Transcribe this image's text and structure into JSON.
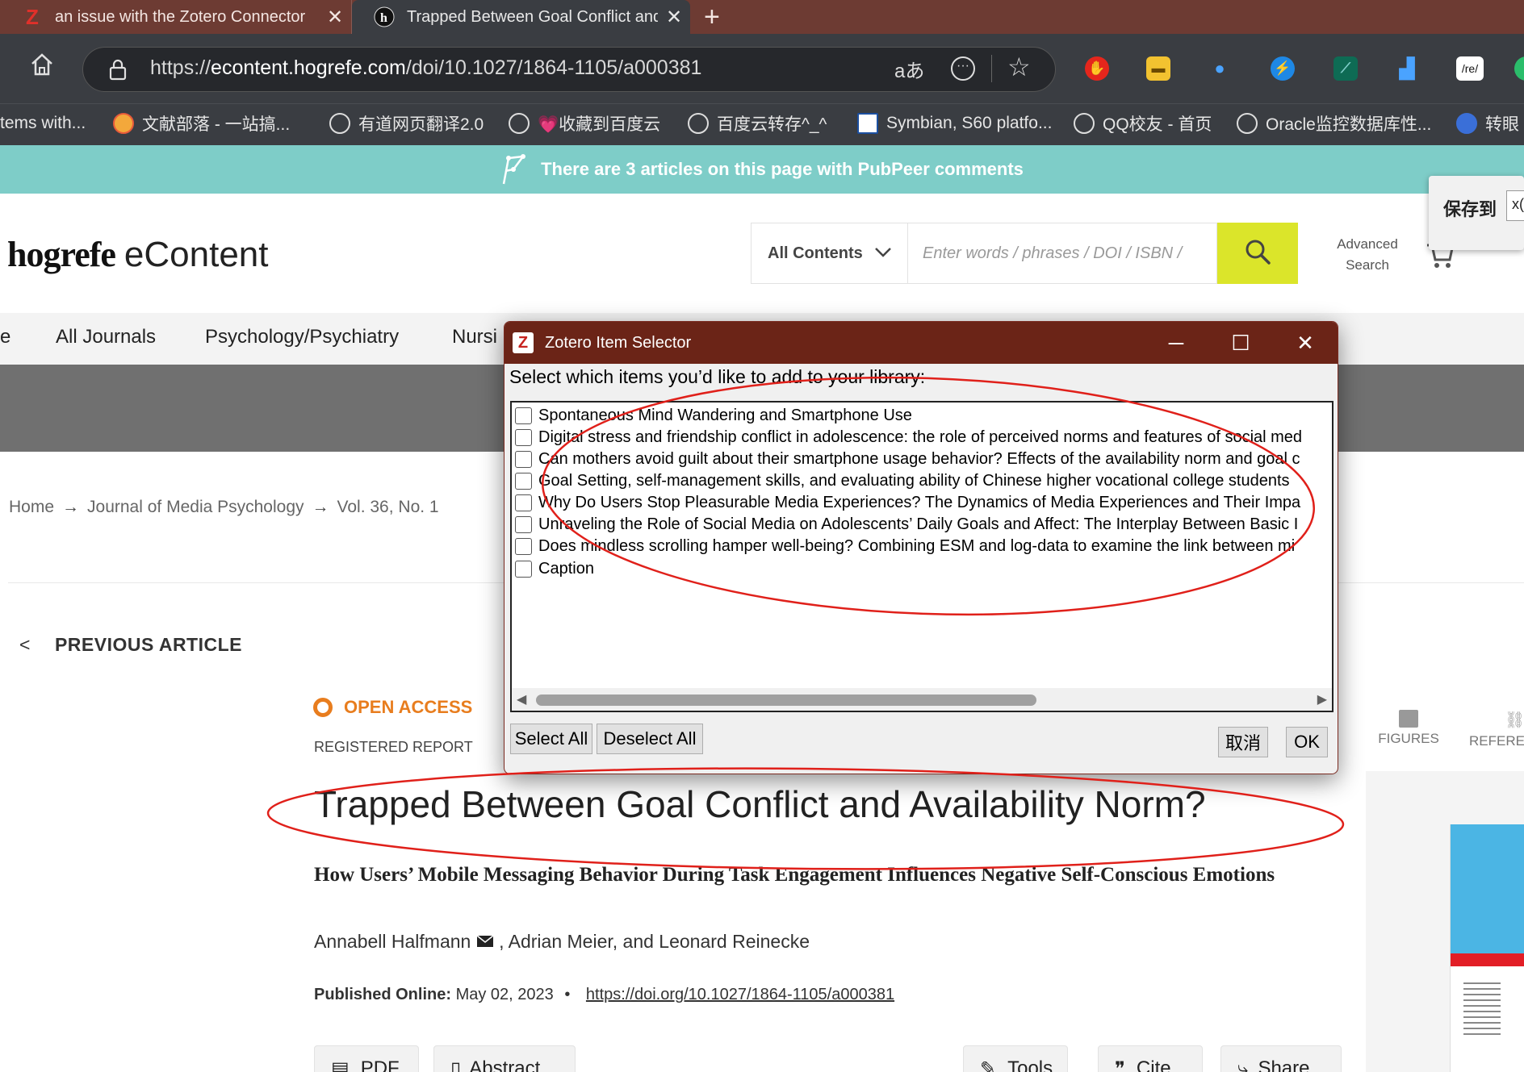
{
  "browser": {
    "tabs": [
      {
        "title": "an issue with the Zotero Connector",
        "active": false
      },
      {
        "title": "Trapped Between Goal Conflict and Availability Norm?",
        "active": true
      }
    ],
    "url_scheme": "https://",
    "url_domain": "econtent.hogrefe.com",
    "url_path": "/doi/10.1027/1864-1105/a000381",
    "toolbar_text": {
      "translate": "aあ",
      "ext_re": "/re/"
    },
    "bookmarks": [
      "tems with...",
      "文献部落 - 一站搞...",
      "有道网页翻译2.0",
      "💗收藏到百度云",
      "百度云转存^_^",
      "Symbian, S60 platfo...",
      "QQ校友 - 首页",
      "Oracle监控数据库性...",
      "转眼"
    ]
  },
  "pubpeer": {
    "message": "There are 3 articles on this page with PubPeer comments"
  },
  "site": {
    "logo_brand": "hogrefe",
    "logo_product": "eContent",
    "search_scope": "All Contents",
    "search_placeholder": "Enter words / phrases / DOI / ISBN /",
    "advanced_search": "Advanced Search",
    "save_to_label": "保存到",
    "save_to_value": "x("
  },
  "nav": [
    "e",
    "All Journals",
    "Psychology/Psychiatry",
    "Nursi"
  ],
  "breadcrumb": [
    "Home",
    "Journal of Media Psychology",
    "Vol. 36, No. 1"
  ],
  "article": {
    "previous_label": "PREVIOUS ARTICLE",
    "access_label": "OPEN ACCESS",
    "type_label": "REGISTERED REPORT",
    "title": "Trapped Between Goal Conflict and Availability Norm?",
    "subtitle": "How Users’ Mobile Messaging Behavior During Task Engagement Influences Negative Self-Conscious Emotions",
    "author_first": "Annabell Halfmann",
    "authors_rest": ", Adrian Meier, and Leonard Reinecke",
    "published_label": "Published Online:",
    "published_date": "May 02, 2023",
    "doi_link": "https://doi.org/10.1027/1864-1105/a000381",
    "buttons": [
      "PDF",
      "Abstract",
      "Tools",
      "Cite",
      "Share"
    ],
    "side_tabs": [
      "FIGURES",
      "REFERE"
    ]
  },
  "dialog": {
    "title": "Zotero Item Selector",
    "prompt": "Select which items you’d like to add to your library:",
    "items": [
      {
        "label": "Spontaneous Mind Wandering and Smartphone Use",
        "checked": false
      },
      {
        "label": "Digital stress and friendship conflict in adolescence: the role of perceived norms and features of social med",
        "checked": false
      },
      {
        "label": "Can mothers avoid guilt about their smartphone usage behavior? Effects of the availability norm and goal c",
        "checked": false
      },
      {
        "label": "Goal Setting, self-management skills, and evaluating ability of Chinese higher vocational college students",
        "checked": false
      },
      {
        "label": "Why Do Users Stop Pleasurable Media Experiences? The Dynamics of Media Experiences and Their Impa",
        "checked": false
      },
      {
        "label": "Unraveling the Role of Social Media on Adolescents’ Daily Goals and Affect: The Interplay Between Basic I",
        "checked": false
      },
      {
        "label": "Does mindless scrolling hamper well-being? Combining ESM and log-data to examine the link between mi",
        "checked": false
      },
      {
        "label": "Caption",
        "checked": false
      }
    ],
    "select_all": "Select All",
    "deselect_all": "Deselect All",
    "cancel": "取消",
    "ok": "OK"
  },
  "colors": {
    "tab_strip": "#6d3b33",
    "browser_chrome": "#3a3d42",
    "pubpeer_banner": "#7ecdc8",
    "search_button": "#dbe52a",
    "open_access": "#e87d1e",
    "dialog_titlebar": "#6b2417",
    "annotation": "#e0201a"
  }
}
